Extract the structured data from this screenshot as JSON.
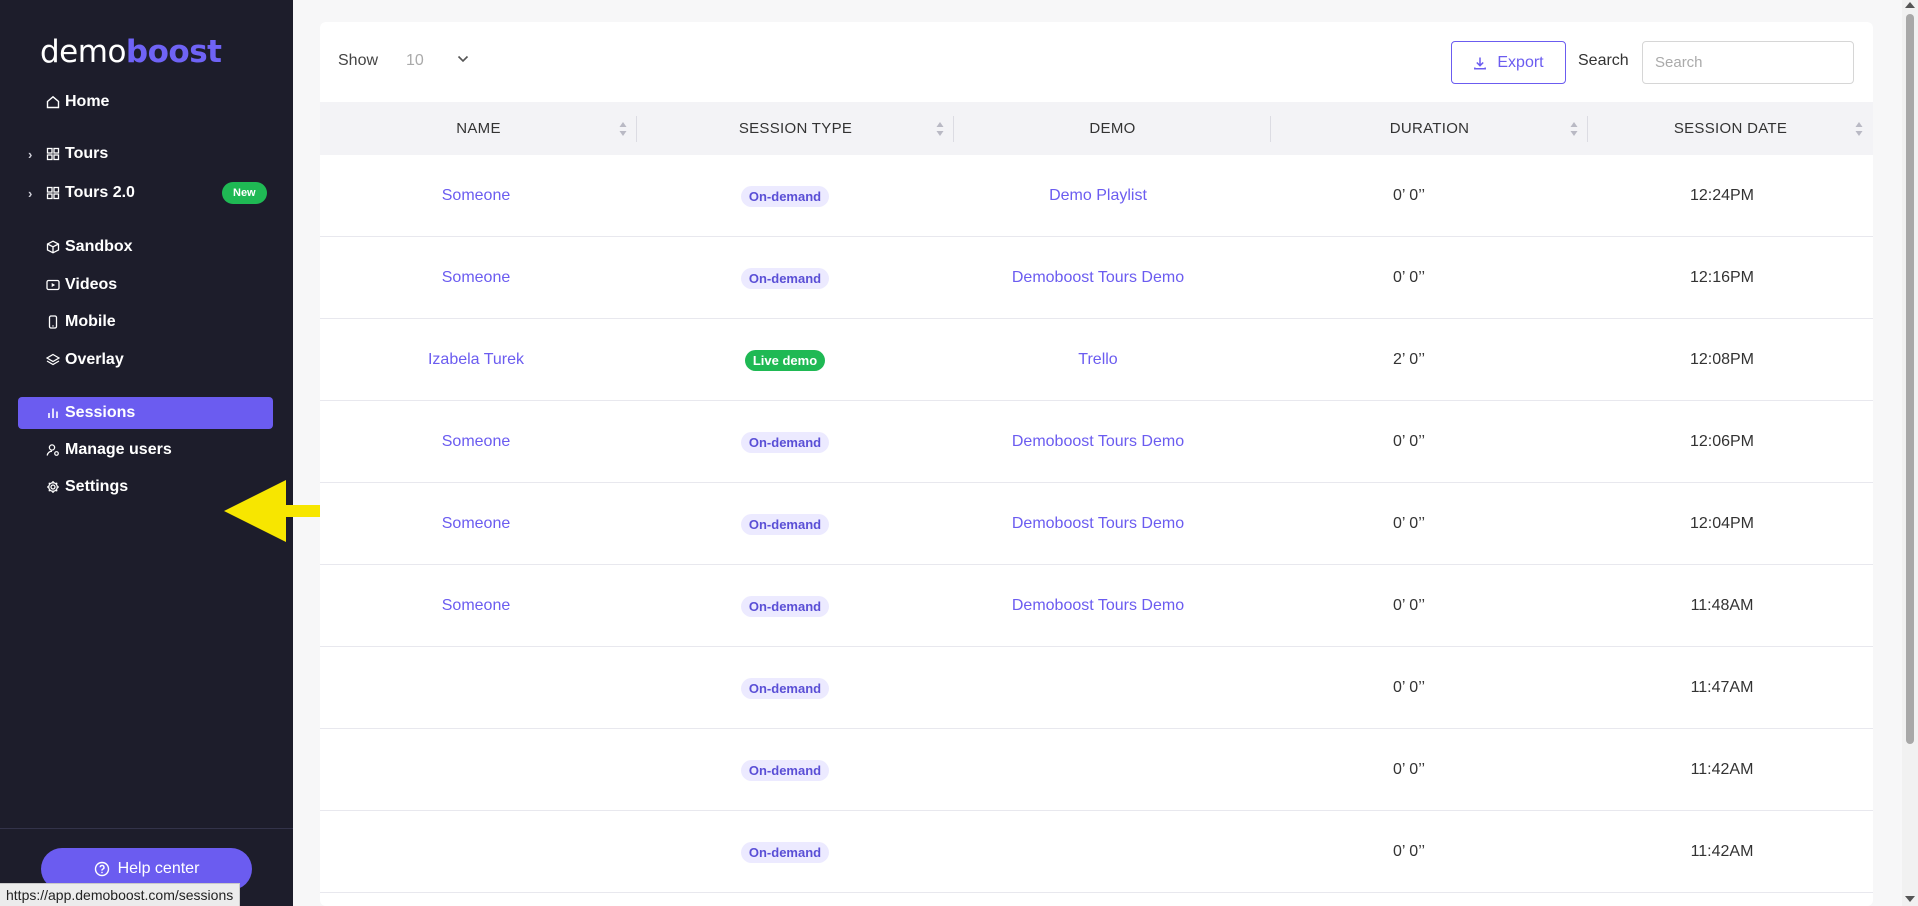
{
  "brand": {
    "part1": "demo",
    "part2": "boost"
  },
  "sidebar": {
    "items": [
      {
        "id": "home",
        "label": "Home",
        "icon": "home-icon",
        "chevron": false
      },
      {
        "id": "tours",
        "label": "Tours",
        "icon": "grid-icon",
        "chevron": true
      },
      {
        "id": "tours2",
        "label": "Tours 2.0",
        "icon": "grid-icon",
        "chevron": true,
        "badge": "New"
      },
      {
        "id": "sandbox",
        "label": "Sandbox",
        "icon": "cube-icon",
        "chevron": false
      },
      {
        "id": "videos",
        "label": "Videos",
        "icon": "video-icon",
        "chevron": false
      },
      {
        "id": "mobile",
        "label": "Mobile",
        "icon": "phone-icon",
        "chevron": false
      },
      {
        "id": "overlay",
        "label": "Overlay",
        "icon": "layers-icon",
        "chevron": false
      },
      {
        "id": "sessions",
        "label": "Sessions",
        "icon": "bar-chart-icon",
        "chevron": false,
        "active": true
      },
      {
        "id": "manage-users",
        "label": "Manage users",
        "icon": "user-gear-icon",
        "chevron": false
      },
      {
        "id": "settings",
        "label": "Settings",
        "icon": "gear-icon",
        "chevron": false
      }
    ],
    "help_label": "Help center"
  },
  "status_url": "https://app.demoboost.com/sessions",
  "toolbar": {
    "show_label": "Show",
    "show_value": "10",
    "export_label": "Export",
    "search_label": "Search",
    "search_placeholder": "Search"
  },
  "table": {
    "columns": [
      "NAME",
      "SESSION TYPE",
      "DEMO",
      "DURATION",
      "SESSION DATE"
    ],
    "rows": [
      {
        "name": "Someone",
        "type": "On-demand",
        "type_style": "ondemand",
        "demo": "Demo Playlist",
        "duration": "0’ 0’’",
        "date": "12:24PM"
      },
      {
        "name": "Someone",
        "type": "On-demand",
        "type_style": "ondemand",
        "demo": "Demoboost Tours Demo",
        "duration": "0’ 0’’",
        "date": "12:16PM"
      },
      {
        "name": "Izabela Turek",
        "type": "Live demo",
        "type_style": "live",
        "demo": "Trello",
        "duration": "2’ 0’’",
        "date": "12:08PM"
      },
      {
        "name": "Someone",
        "type": "On-demand",
        "type_style": "ondemand",
        "demo": "Demoboost Tours Demo",
        "duration": "0’ 0’’",
        "date": "12:06PM"
      },
      {
        "name": "Someone",
        "type": "On-demand",
        "type_style": "ondemand",
        "demo": "Demoboost Tours Demo",
        "duration": "0’ 0’’",
        "date": "12:04PM"
      },
      {
        "name": "Someone",
        "type": "On-demand",
        "type_style": "ondemand",
        "demo": "Demoboost Tours Demo",
        "duration": "0’ 0’’",
        "date": "11:48AM"
      },
      {
        "name": "",
        "type": "On-demand",
        "type_style": "ondemand",
        "demo": "",
        "duration": "0’ 0’’",
        "date": "11:47AM"
      },
      {
        "name": "",
        "type": "On-demand",
        "type_style": "ondemand",
        "demo": "",
        "duration": "0’ 0’’",
        "date": "11:42AM"
      },
      {
        "name": "",
        "type": "On-demand",
        "type_style": "ondemand",
        "demo": "",
        "duration": "0’ 0’’",
        "date": "11:42AM"
      }
    ]
  },
  "colors": {
    "accent": "#6b5cf0",
    "sidebar_bg": "#1d1d2b",
    "live_green": "#1fb954",
    "arrow_yellow": "#f7e600"
  }
}
